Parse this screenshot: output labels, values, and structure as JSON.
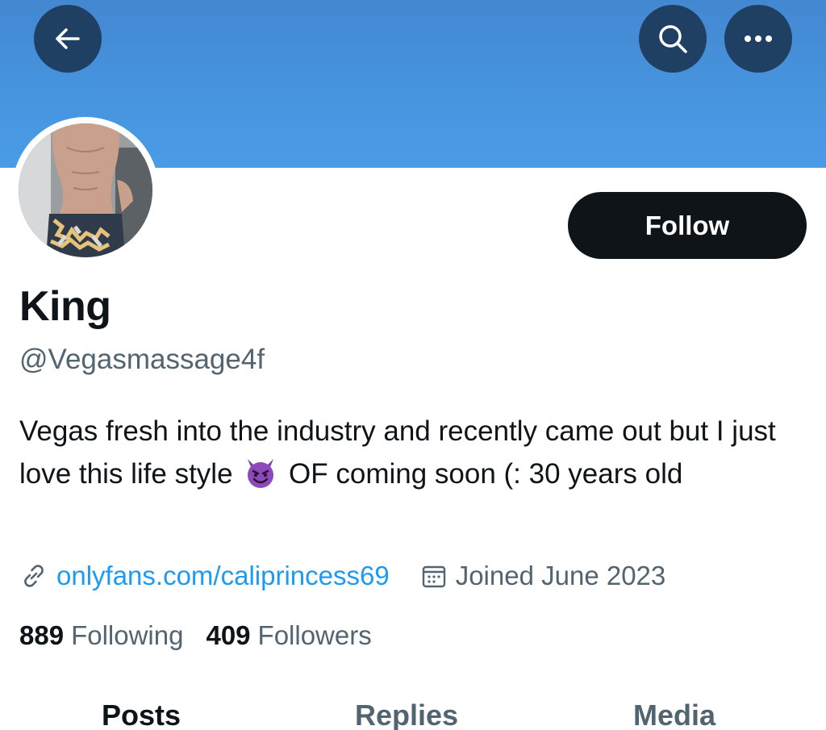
{
  "header": {
    "banner_color": "#4795df",
    "buttons": [
      "back-icon",
      "search-icon",
      "more-icon"
    ]
  },
  "profile": {
    "name": "King",
    "handle": "@Vegasmassage4f",
    "follow_label": "Follow",
    "bio_part1": "Vegas fresh into the industry and recently came out but I just love this life style",
    "bio_emoji": "smiling-devil-emoji",
    "bio_part2": "OF coming soon (: 30 years old",
    "link": "onlyfans.com/caliprincess69",
    "joined": "Joined June 2023",
    "following_count": "889",
    "following_label": "Following",
    "followers_count": "409",
    "followers_label": "Followers"
  },
  "tabs": [
    {
      "label": "Posts"
    },
    {
      "label": "Replies"
    },
    {
      "label": "Media"
    }
  ],
  "colors": {
    "accent": "#1d9bf0",
    "secondary_text": "#536471",
    "primary_text": "#0f1419"
  }
}
